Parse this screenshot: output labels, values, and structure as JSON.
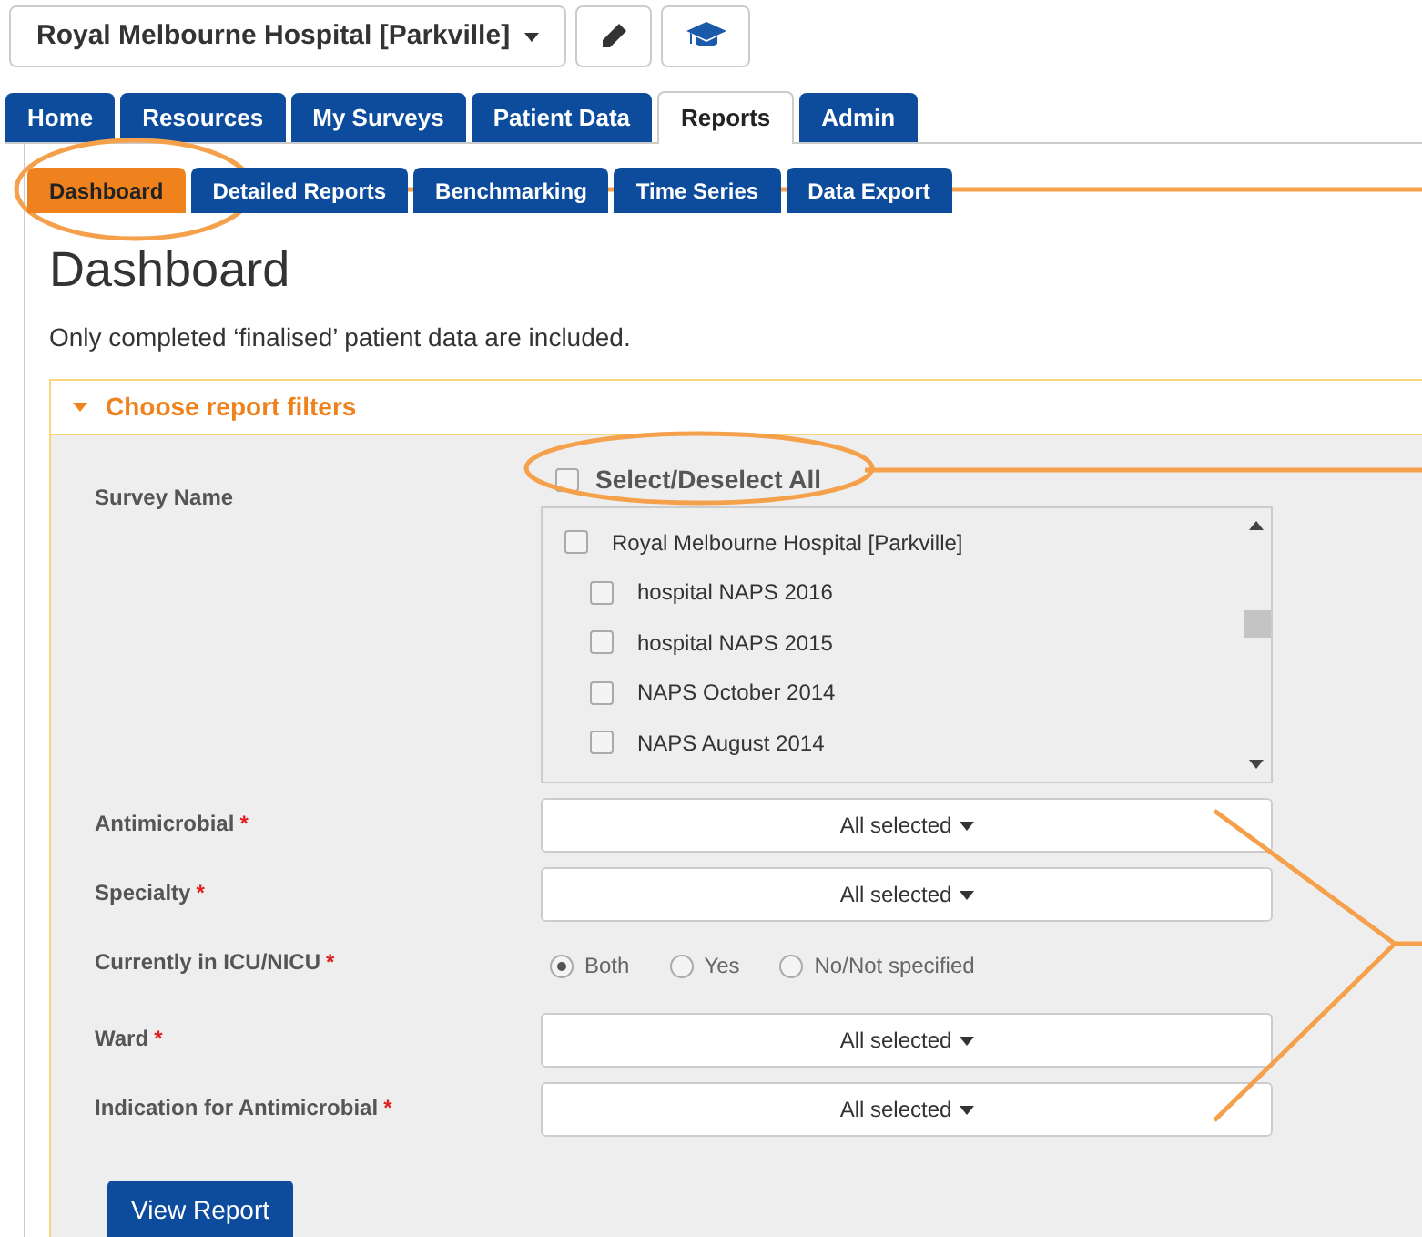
{
  "site_selector": {
    "label": "Royal Melbourne Hospital [Parkville]"
  },
  "main_tabs": [
    {
      "label": "Home",
      "selected": false
    },
    {
      "label": "Resources",
      "selected": false
    },
    {
      "label": "My Surveys",
      "selected": false
    },
    {
      "label": "Patient Data",
      "selected": false
    },
    {
      "label": "Reports",
      "selected": true
    },
    {
      "label": "Admin",
      "selected": false
    }
  ],
  "sub_tabs": [
    {
      "label": "Dashboard",
      "selected": true
    },
    {
      "label": "Detailed Reports",
      "selected": false
    },
    {
      "label": "Benchmarking",
      "selected": false
    },
    {
      "label": "Time Series",
      "selected": false
    },
    {
      "label": "Data Export",
      "selected": false
    }
  ],
  "heading": "Dashboard",
  "note": "Only completed ‘finalised’ patient data are included.",
  "filters_panel": {
    "title": "Choose report filters",
    "expanded": true,
    "filters": [
      {
        "kind": "checklist",
        "label": "Survey Name",
        "select_all": {
          "label": "Select/Deselect All",
          "checked": false
        },
        "items": [
          {
            "label": "Royal Melbourne Hospital [Parkville]",
            "checked": false,
            "children": [
              {
                "label": "hospital NAPS 2016",
                "checked": false
              },
              {
                "label": "hospital NAPS 2015",
                "checked": false
              },
              {
                "label": "NAPS October 2014",
                "checked": false
              },
              {
                "label": "NAPS August 2014",
                "checked": false
              }
            ]
          }
        ]
      },
      {
        "kind": "multiselect",
        "label": "Antimicrobial",
        "required_mark": "*",
        "value": "All selected"
      },
      {
        "kind": "multiselect",
        "label": "Specialty",
        "required_mark": "*",
        "value": "All selected"
      },
      {
        "kind": "radio",
        "label": "Currently in ICU/NICU",
        "required_mark": "*",
        "options": [
          {
            "label": "Both",
            "selected": true
          },
          {
            "label": "Yes",
            "selected": false
          },
          {
            "label": "No/Not specified",
            "selected": false
          }
        ]
      },
      {
        "kind": "multiselect",
        "label": "Ward",
        "required_mark": "*",
        "value": "All selected"
      },
      {
        "kind": "multiselect",
        "label": "Indication for Antimicrobial",
        "required_mark": "*",
        "value": "All selected"
      }
    ]
  },
  "view_button": "View Report"
}
